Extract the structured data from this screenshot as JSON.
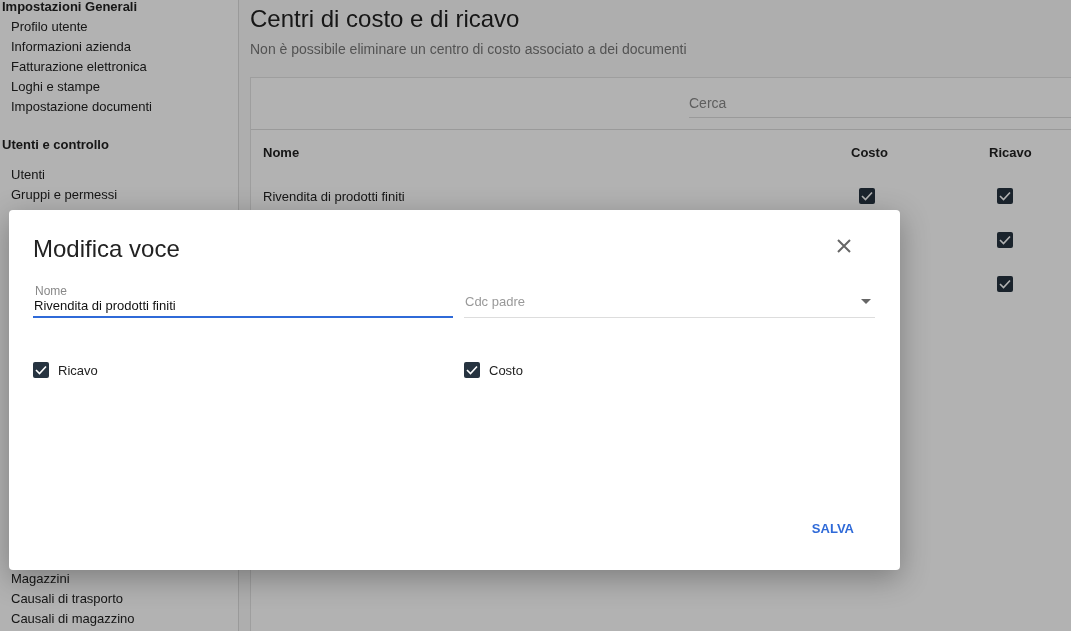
{
  "sidebar": {
    "sections": [
      {
        "heading": "Impostazioni Generali",
        "items": [
          "Profilo utente",
          "Informazioni azienda",
          "Fatturazione elettronica",
          "Loghi e stampe",
          "Impostazione documenti"
        ]
      },
      {
        "heading": "Utenti e controllo",
        "items": [
          "Utenti",
          "Gruppi e permessi"
        ]
      },
      {
        "items": [
          "Magazzini",
          "Causali di trasporto",
          "Causali di magazzino"
        ]
      }
    ]
  },
  "page": {
    "title": "Centri di costo e di ricavo",
    "subtitle": "Non è possibile eliminare un centro di costo associato a dei documenti"
  },
  "search": {
    "placeholder": "Cerca"
  },
  "table": {
    "columns": [
      "Nome",
      "Costo",
      "Ricavo"
    ],
    "rows": [
      {
        "name": "Rivendita di prodotti finiti",
        "costo": true,
        "ricavo": true
      },
      {
        "ricavo": true
      },
      {
        "ricavo": true
      }
    ]
  },
  "dialog": {
    "title": "Modifica voce",
    "fields": [
      {
        "kind": "text",
        "label": "Nome",
        "value": "Rivendita di prodotti finiti",
        "focused": true
      },
      {
        "kind": "select",
        "placeholder": "Cdc padre",
        "focused": false
      }
    ],
    "checkboxes": [
      {
        "label": "Ricavo",
        "checked": true
      },
      {
        "label": "Costo",
        "checked": true
      }
    ],
    "button": "SALVA"
  }
}
